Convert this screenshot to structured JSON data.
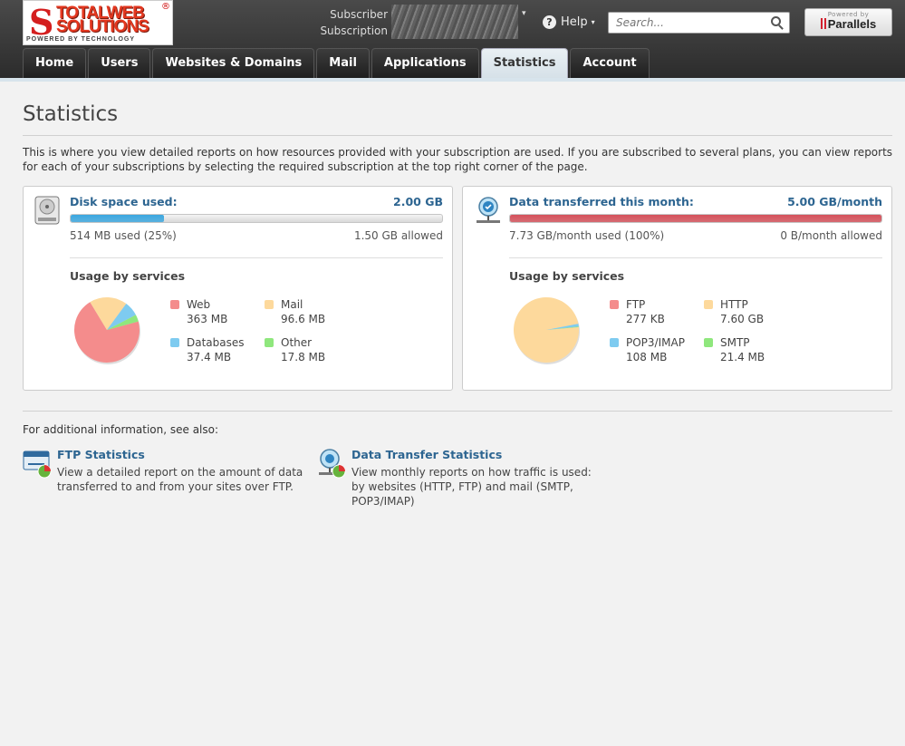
{
  "header": {
    "logo_line1": "TOTALWEB",
    "logo_line2": "SOLUTIONS",
    "logo_tagline": "POWERED BY TECHNOLOGY",
    "subscriber_label": "Subscriber",
    "subscription_label": "Subscription",
    "help_label": "Help",
    "search_placeholder": "Search...",
    "powered_by": "Powered by",
    "parallels": "Parallels"
  },
  "nav": {
    "tabs": [
      {
        "label": "Home"
      },
      {
        "label": "Users"
      },
      {
        "label": "Websites & Domains"
      },
      {
        "label": "Mail"
      },
      {
        "label": "Applications"
      },
      {
        "label": "Statistics",
        "active": true
      },
      {
        "label": "Account"
      }
    ]
  },
  "page": {
    "title": "Statistics",
    "intro": "This is where you view detailed reports on how resources provided with your subscription are used. If you are subscribed to several plans, you can view reports for each of your subscriptions by selecting the required subscription at the top right corner of the page."
  },
  "disk": {
    "title": "Disk space used:",
    "total": "2.00 GB",
    "used": "514 MB used (25%)",
    "allowed": "1.50 GB allowed",
    "percent": 25,
    "bar_color": "#3aa6df",
    "services_title": "Usage by services",
    "services": [
      {
        "name": "Web",
        "value": "363 MB",
        "color": "#f48c8c",
        "mb": 363
      },
      {
        "name": "Mail",
        "value": "96.6 MB",
        "color": "#fdd99c",
        "mb": 96.6
      },
      {
        "name": "Databases",
        "value": "37.4 MB",
        "color": "#7ecbf0",
        "mb": 37.4
      },
      {
        "name": "Other",
        "value": "17.8 MB",
        "color": "#8fe77d",
        "mb": 17.8
      }
    ]
  },
  "traffic": {
    "title": "Data transferred this month:",
    "total": "5.00 GB/month",
    "used": "7.73 GB/month used (100%)",
    "allowed": "0 B/month allowed",
    "percent": 100,
    "bar_color": "#d4505a",
    "services_title": "Usage by services",
    "services": [
      {
        "name": "FTP",
        "value": "277 KB",
        "color": "#f48c8c",
        "mb": 0.27
      },
      {
        "name": "HTTP",
        "value": "7.60 GB",
        "color": "#fdd99c",
        "mb": 7782
      },
      {
        "name": "POP3/IMAP",
        "value": "108 MB",
        "color": "#7ecbf0",
        "mb": 108
      },
      {
        "name": "SMTP",
        "value": "21.4 MB",
        "color": "#8fe77d",
        "mb": 21.4
      }
    ]
  },
  "see_also": {
    "label": "For additional information, see also:",
    "links": [
      {
        "title": "FTP Statistics",
        "desc": "View a detailed report on the amount of data transferred to and from your sites over FTP."
      },
      {
        "title": "Data Transfer Statistics",
        "desc": "View monthly reports on how traffic is used: by websites (HTTP, FTP) and mail (SMTP, POP3/IMAP)"
      }
    ]
  }
}
